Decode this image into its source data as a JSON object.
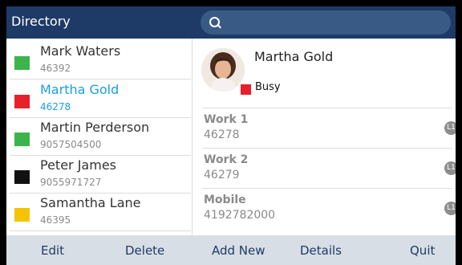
{
  "header": {
    "title": "Directory"
  },
  "contacts": [
    {
      "name": "Mark Waters",
      "number": "46392",
      "color": "#3cb44b"
    },
    {
      "name": "Martha Gold",
      "number": "46278",
      "color": "#e8202a"
    },
    {
      "name": "Martin Perderson",
      "number": "9057504500",
      "color": "#3cb44b"
    },
    {
      "name": "Peter James",
      "number": "9055971727",
      "color": "#111111"
    },
    {
      "name": "Samantha Lane",
      "number": "46395",
      "color": "#f5c400"
    }
  ],
  "selected_contact_index": 1,
  "detail": {
    "name": "Martha Gold",
    "status": "Busy",
    "status_color": "#e8202a",
    "fields": [
      {
        "label": "Work 1",
        "value": "46278",
        "line": "L1"
      },
      {
        "label": "Work 2",
        "value": "46279",
        "line": "L1"
      },
      {
        "label": "Mobile",
        "value": "4192782000",
        "line": "L1"
      }
    ]
  },
  "softkeys": {
    "edit": "Edit",
    "delete": "Delete",
    "add_new": "Add New",
    "details": "Details",
    "quit": "Quit"
  }
}
